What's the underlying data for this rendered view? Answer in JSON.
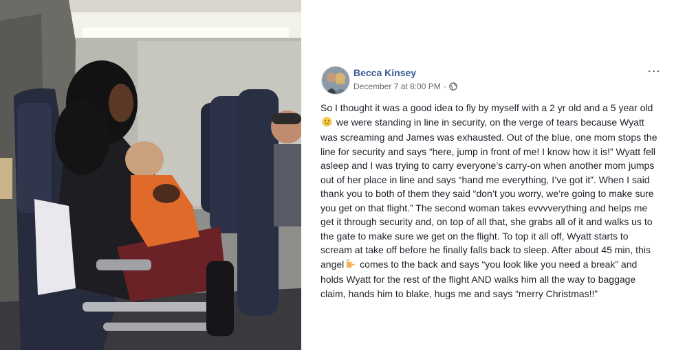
{
  "post": {
    "author": "Becca Kinsey",
    "timestamp": "December 7 at 8:00 PM",
    "separator": "·",
    "privacy_icon": "globe-icon",
    "more_label": "···",
    "text_1": "So I thought it was a good idea to fly by myself with a 2 yr old and a 5 year old",
    "emoji_1": "worried-face-emoji",
    "text_2": " we were standing in line in security, on the verge of tears because Wyatt was screaming and James was exhausted. Out of the blue, one mom stops the line for security and says “here, jump in front of me! I know how it is!” Wyatt fell asleep and I was trying to carry everyone’s carry-on when another mom jumps out of her place in line and says “hand me everything, I’ve got it”. When I said thank you to both of them they said “don’t you worry, we’re going to make sure you get on that flight.” The second woman takes evvvverything and helps me get it through security and, on top of all that, she grabs all of it and walks us to the gate to make sure we get on the flight. To top it all off, Wyatt starts to scream at take off before he finally falls back to sleep. After about 45 min, this angel",
    "emoji_2": "pointing-hand-emoji",
    "text_3": " comes to the back and says “you look like you need a break” and holds Wyatt for the rest of the flight AND walks him all the way to baggage claim, hands him to blake, hugs me and says “merry Christmas!!”"
  },
  "colors": {
    "author_link": "#385898",
    "meta_text": "#606770",
    "body_text": "#1d2129"
  }
}
